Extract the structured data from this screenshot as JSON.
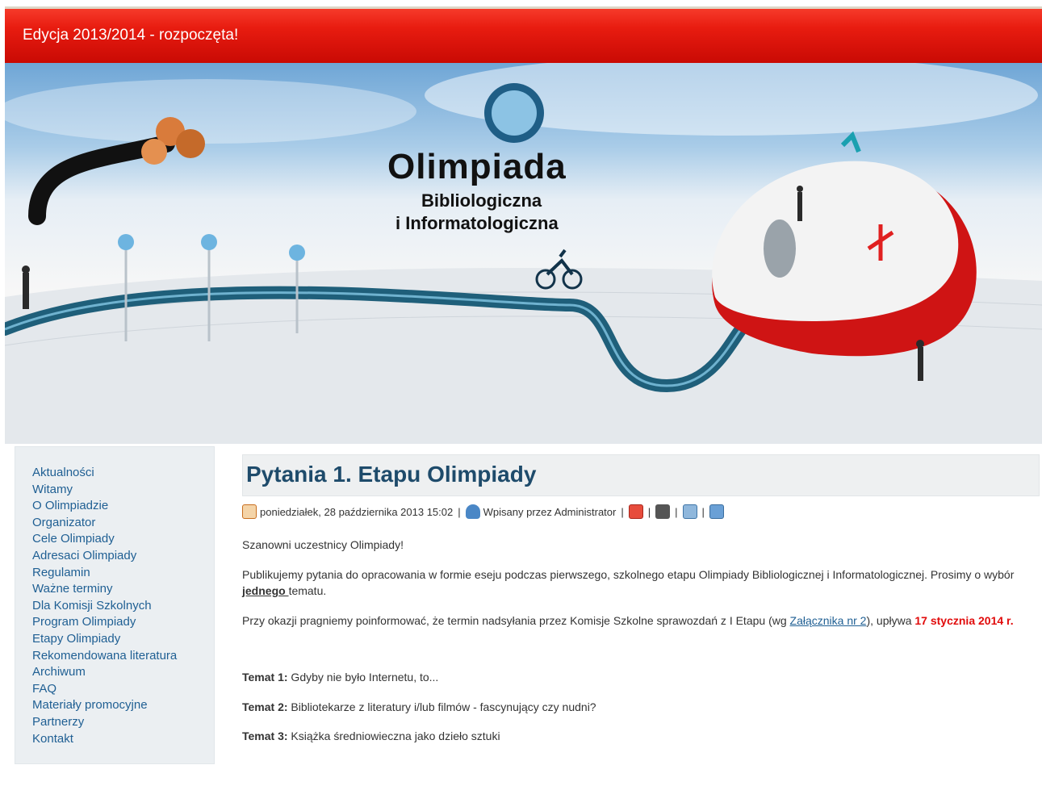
{
  "topbar": {
    "announcement": "Edycja 2013/2014 - rozpoczęta!"
  },
  "banner": {
    "title": "Olimpiada",
    "subtitle1": "Bibliologiczna",
    "subtitle2": "i Informatologiczna"
  },
  "sidebar": {
    "items": [
      "Aktualności",
      "Witamy",
      "O Olimpiadzie",
      "Organizator",
      "Cele Olimpiady",
      "Adresaci Olimpiady",
      "Regulamin",
      "Ważne terminy",
      "Dla Komisji Szkolnych",
      "Program Olimpiady",
      "Etapy Olimpiady",
      "Rekomendowana literatura",
      "Archiwum",
      "FAQ",
      "Materiały promocyjne",
      "Partnerzy",
      "Kontakt"
    ]
  },
  "article": {
    "title": "Pytania 1. Etapu Olimpiady",
    "date": "poniedziałek, 28 października 2013 15:02",
    "author": "Wpisany przez Administrator",
    "icons": [
      "calendar-icon",
      "user-icon",
      "pdf-icon",
      "print-icon",
      "email-icon",
      "edit-icon"
    ],
    "greeting": "Szanowni uczestnicy Olimpiady!",
    "para1_text": "Publikujemy pytania do opracowania w formie eseju podczas pierwszego, szkolnego etapu Olimpiady Bibliologicznej i Informatologicznej. Prosimy o wybór ",
    "para1_bold": "jednego ",
    "para1_end": "tematu.",
    "para2_text": "Przy okazji pragniemy poinformować, że termin nadsyłania przez Komisje Szkolne sprawozdań z I Etapu (wg ",
    "para2_link": "Załącznika nr 2",
    "para2_mid": "), upływa ",
    "para2_red": "17 stycznia 2014 r.",
    "topics": [
      {
        "label": "Temat 1:",
        "text": " Gdyby nie było Internetu, to..."
      },
      {
        "label": "Temat 2:",
        "text": " Bibliotekarze z literatury i/lub filmów - fascynujący czy nudni?"
      },
      {
        "label": "Temat 3:",
        "text": " Książka średniowieczna jako dzieło sztuki"
      }
    ]
  }
}
